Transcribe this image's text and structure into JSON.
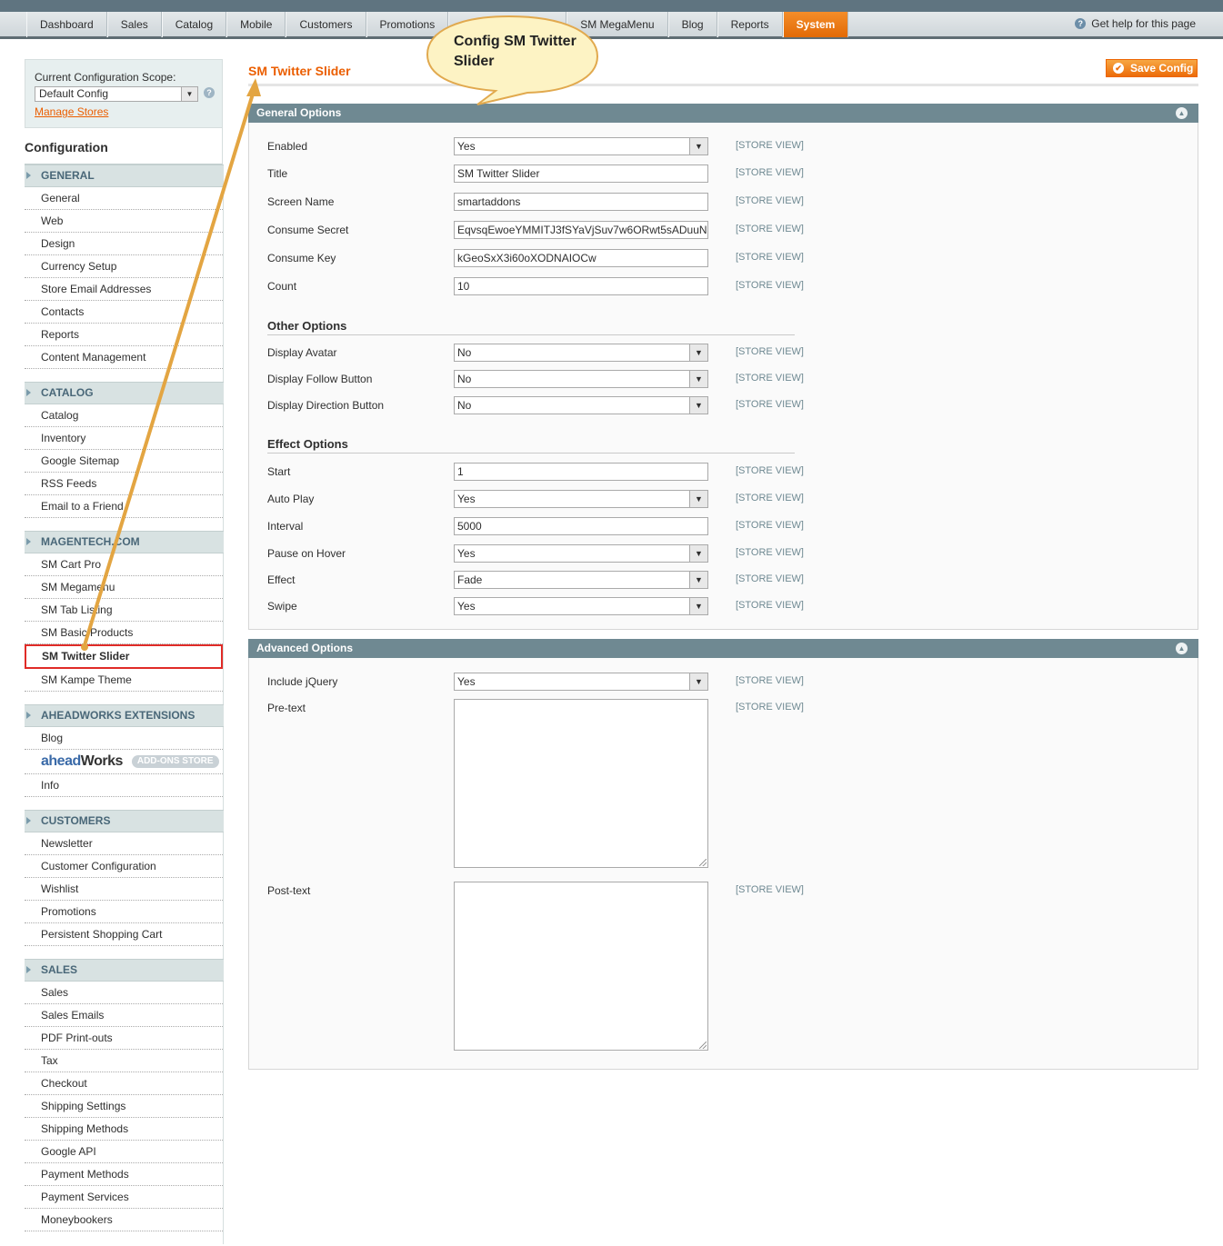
{
  "nav": {
    "items": [
      "Dashboard",
      "Sales",
      "Catalog",
      "Mobile",
      "Customers",
      "Promotions",
      "",
      "SM MegaMenu",
      "Blog",
      "Reports",
      "System"
    ],
    "active_index": 10,
    "help": "Get help for this page"
  },
  "scope": {
    "label": "Current Configuration Scope:",
    "value": "Default Config",
    "manage_stores": "Manage Stores"
  },
  "sidebar": {
    "title": "Configuration",
    "sections": [
      {
        "title": "GENERAL",
        "items": [
          "General",
          "Web",
          "Design",
          "Currency Setup",
          "Store Email Addresses",
          "Contacts",
          "Reports",
          "Content Management"
        ]
      },
      {
        "title": "CATALOG",
        "items": [
          "Catalog",
          "Inventory",
          "Google Sitemap",
          "RSS Feeds",
          "Email to a Friend"
        ]
      },
      {
        "title": "MAGENTECH.COM",
        "items": [
          "SM Cart Pro",
          "SM Megamenu",
          "SM Tab Listing",
          "SM Basic Products",
          "SM Twitter Slider",
          "SM Kampe Theme"
        ],
        "selected": 4
      },
      {
        "title": "AHEADWORKS EXTENSIONS",
        "items": [
          "Blog",
          "__logo__",
          "Info"
        ]
      },
      {
        "title": "CUSTOMERS",
        "items": [
          "Newsletter",
          "Customer Configuration",
          "Wishlist",
          "Promotions",
          "Persistent Shopping Cart"
        ]
      },
      {
        "title": "SALES",
        "items": [
          "Sales",
          "Sales Emails",
          "PDF Print-outs",
          "Tax",
          "Checkout",
          "Shipping Settings",
          "Shipping Methods",
          "Google API",
          "Payment Methods",
          "Payment Services",
          "Moneybookers"
        ]
      }
    ],
    "aw_logo": {
      "ahead": "ahead",
      "works": "Works",
      "store": "ADD-ONS STORE"
    }
  },
  "page": {
    "title": "SM Twitter Slider",
    "save_label": "Save Config",
    "callout": "Config SM Twitter Slider"
  },
  "general": {
    "title": "General Options",
    "scope_tag": "[STORE VIEW]",
    "fields": [
      {
        "label": "Enabled",
        "value": "Yes",
        "type": "select"
      },
      {
        "label": "Title",
        "value": "SM Twitter Slider",
        "type": "text"
      },
      {
        "label": "Screen Name",
        "value": "smartaddons",
        "type": "text"
      },
      {
        "label": "Consume Secret",
        "value": "EqvsqEwoeYMMITJ3fSYaVjSuv7w6ORwt5sADuuN",
        "type": "text"
      },
      {
        "label": "Consume Key",
        "value": "kGeoSxX3i60oXODNAIOCw",
        "type": "text"
      },
      {
        "label": "Count",
        "value": "10",
        "type": "text"
      }
    ],
    "other_title": "Other Options",
    "other_fields": [
      {
        "label": "Display Avatar",
        "value": "No",
        "type": "select"
      },
      {
        "label": "Display Follow Button",
        "value": "No",
        "type": "select"
      },
      {
        "label": "Display Direction Button",
        "value": "No",
        "type": "select"
      }
    ],
    "effect_title": "Effect Options",
    "effect_fields": [
      {
        "label": "Start",
        "value": "1",
        "type": "text"
      },
      {
        "label": "Auto Play",
        "value": "Yes",
        "type": "select"
      },
      {
        "label": "Interval",
        "value": "5000",
        "type": "text"
      },
      {
        "label": "Pause on Hover",
        "value": "Yes",
        "type": "select"
      },
      {
        "label": "Effect",
        "value": "Fade",
        "type": "select"
      },
      {
        "label": "Swipe",
        "value": "Yes",
        "type": "select"
      }
    ]
  },
  "advanced": {
    "title": "Advanced Options",
    "include_jquery": {
      "label": "Include jQuery",
      "value": "Yes"
    },
    "pre_text": {
      "label": "Pre-text",
      "value": ""
    },
    "post_text": {
      "label": "Post-text",
      "value": ""
    }
  },
  "colors": {
    "accent": "#eb5e00",
    "header": "#6f8992",
    "highlight": "#e02b27",
    "arrow": "#e3a542"
  }
}
